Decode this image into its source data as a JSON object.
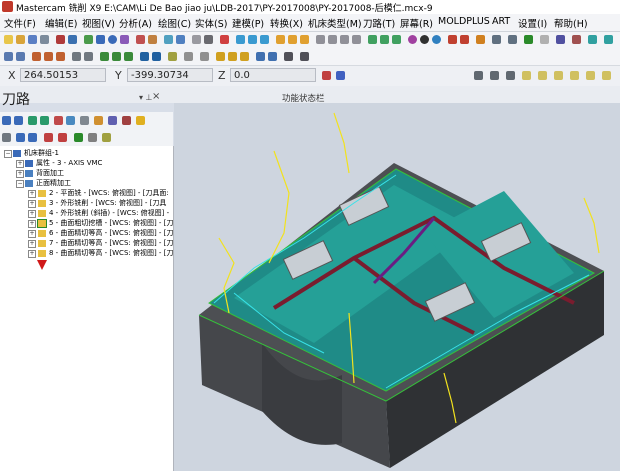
{
  "window": {
    "title": "Mastercam 铣削 X9  E:\\CAM\\Li De Bao jiao ju\\LDB-2017\\PY-2017008\\PY-2017008-后模仁.mcx-9"
  },
  "menu": [
    "文件(F)",
    "编辑(E)",
    "视图(V)",
    "分析(A)",
    "绘图(C)",
    "实体(S)",
    "建模(P)",
    "转换(X)",
    "机床类型(M)",
    "刀路(T)",
    "屏幕(R)",
    "MOLDPLUS",
    "ART",
    "设置(I)",
    "帮助(H)"
  ],
  "coords": {
    "x_label": "X",
    "x_value": "264.50153",
    "y_label": "Y",
    "y_value": "-399.30734",
    "z_label": "Z",
    "z_value": "0.0"
  },
  "panel": {
    "title": "刀路",
    "pin": "▾ ⊥",
    "close": "×"
  },
  "status_bar": {
    "label": "功能状态栏"
  },
  "tree": {
    "root": "机床群组-1",
    "properties": "属性 - 3 - AXIS VMC",
    "groups": [
      "背面加工",
      "正面精加工"
    ],
    "ops": [
      {
        "label": "2 - 平面铣 - [WCS: 俯视图] - [刀具面:"
      },
      {
        "label": "3 - 外形铣削 - [WCS: 俯视图] - [刀具"
      },
      {
        "label": "4 - 外形铣削 (斜插) - [WCS: 俯视图] -"
      },
      {
        "label": "5 - 曲面粗切挖槽 - [WCS: 俯视图] - [刀"
      },
      {
        "label": "6 - 曲面精切等高 - [WCS: 俯视图] - [刀"
      },
      {
        "label": "7 - 曲面精切等高 - [WCS: 俯视图] - [刀"
      },
      {
        "label": "8 - 曲面精切等高 - [WCS: 俯视图] - [刀"
      }
    ]
  },
  "colors": {
    "cavity": "#1d8a86",
    "cavity_top": "#2aa49b",
    "base": "#4a4c50",
    "base_side": "#383a3e",
    "runner": "#7a1c2e",
    "toolpath_yellow": "#f2e21e",
    "toolpath_cyan": "#38e2e8",
    "toolpath_purple": "#6a1d82",
    "edge_green": "#35c23a"
  }
}
